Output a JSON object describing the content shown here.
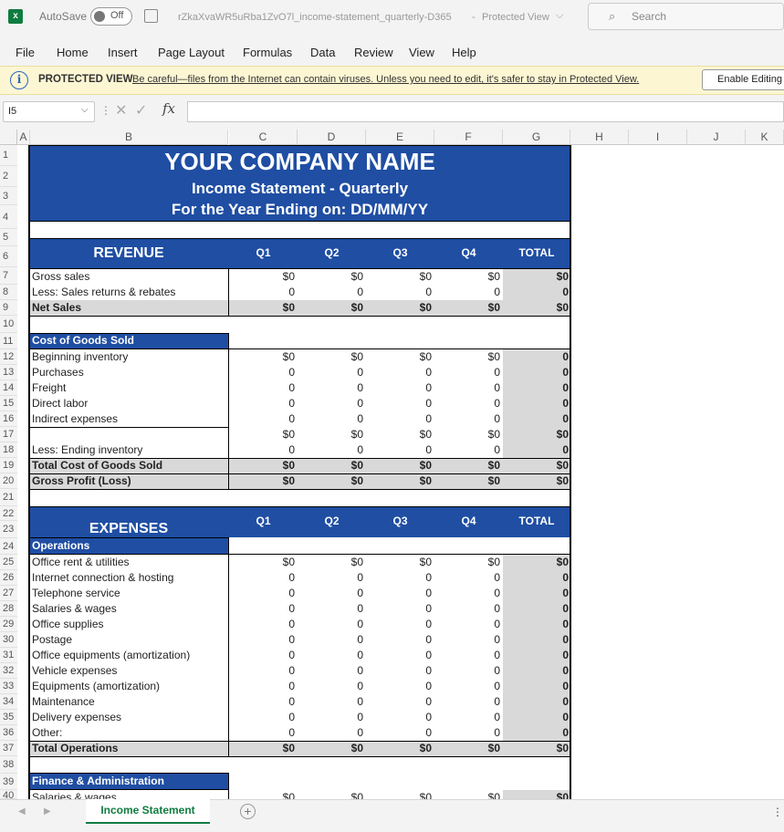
{
  "titlebar": {
    "autosave_label": "AutoSave",
    "autosave_state": "Off",
    "filename": "rZkaXvaWR5uRba1ZvO7l_income-statement_quarterly-D365",
    "separator": "-",
    "view_mode": "Protected View",
    "search_placeholder": "Search"
  },
  "menu": [
    "File",
    "Home",
    "Insert",
    "Page Layout",
    "Formulas",
    "Data",
    "Review",
    "View",
    "Help"
  ],
  "protected": {
    "label": "PROTECTED VIEW",
    "message": "Be careful—files from the Internet can contain viruses. Unless you need to edit, it's safer to stay in Protected View.",
    "button": "Enable Editing"
  },
  "formula_bar": {
    "cell_ref": "I5",
    "fx": "fx",
    "value": ""
  },
  "columns": [
    "A",
    "B",
    "C",
    "D",
    "E",
    "F",
    "G",
    "H",
    "I",
    "J",
    "K"
  ],
  "rows": [
    "1",
    "2",
    "3",
    "4",
    "5",
    "6",
    "7",
    "8",
    "9",
    "10",
    "11",
    "12",
    "13",
    "14",
    "15",
    "16",
    "17",
    "18",
    "19",
    "20",
    "21",
    "22",
    "23",
    "24",
    "25",
    "26",
    "27",
    "28",
    "29",
    "30",
    "31",
    "32",
    "33",
    "34",
    "35",
    "36",
    "37",
    "38",
    "39",
    "40"
  ],
  "sheet": {
    "company": "YOUR COMPANY NAME",
    "subtitle": "Income Statement - Quarterly",
    "year_ending": "For the Year Ending on: DD/MM/YY",
    "revenue_title": "REVENUE",
    "expenses_title": "EXPENSES",
    "q_headers": [
      "Q1",
      "Q2",
      "Q3",
      "Q4",
      "TOTAL"
    ],
    "cogs_title": "Cost of Goods Sold",
    "operations_title": "Operations",
    "finance_title": "Finance & Administration",
    "finance_first_row": "Salaries & wages"
  },
  "revenue_rows": [
    {
      "label": "Gross sales",
      "vals": [
        "$0",
        "$0",
        "$0",
        "$0",
        "$0"
      ]
    },
    {
      "label": "Less: Sales returns & rebates",
      "vals": [
        "0",
        "0",
        "0",
        "0",
        "0"
      ]
    },
    {
      "label": "Net Sales",
      "vals": [
        "$0",
        "$0",
        "$0",
        "$0",
        "$0"
      ]
    }
  ],
  "cogs_rows": [
    {
      "label": "Beginning inventory",
      "vals": [
        "$0",
        "$0",
        "$0",
        "$0",
        "0"
      ]
    },
    {
      "label": "Purchases",
      "vals": [
        "0",
        "0",
        "0",
        "0",
        "0"
      ]
    },
    {
      "label": "Freight",
      "vals": [
        "0",
        "0",
        "0",
        "0",
        "0"
      ]
    },
    {
      "label": "Direct labor",
      "vals": [
        "0",
        "0",
        "0",
        "0",
        "0"
      ]
    },
    {
      "label": "Indirect expenses",
      "vals": [
        "0",
        "0",
        "0",
        "0",
        "0"
      ]
    },
    {
      "label": "",
      "vals": [
        "$0",
        "$0",
        "$0",
        "$0",
        "$0"
      ]
    },
    {
      "label": "Less: Ending inventory",
      "vals": [
        "0",
        "0",
        "0",
        "0",
        "0"
      ]
    },
    {
      "label": "Total Cost of Goods Sold",
      "vals": [
        "$0",
        "$0",
        "$0",
        "$0",
        "$0"
      ]
    },
    {
      "label": "Gross Profit (Loss)",
      "vals": [
        "$0",
        "$0",
        "$0",
        "$0",
        "$0"
      ]
    }
  ],
  "operations_rows": [
    {
      "label": "Office rent & utilities",
      "vals": [
        "$0",
        "$0",
        "$0",
        "$0",
        "$0"
      ]
    },
    {
      "label": "Internet connection & hosting",
      "vals": [
        "0",
        "0",
        "0",
        "0",
        "0"
      ]
    },
    {
      "label": "Telephone service",
      "vals": [
        "0",
        "0",
        "0",
        "0",
        "0"
      ]
    },
    {
      "label": "Salaries & wages",
      "vals": [
        "0",
        "0",
        "0",
        "0",
        "0"
      ]
    },
    {
      "label": "Office supplies",
      "vals": [
        "0",
        "0",
        "0",
        "0",
        "0"
      ]
    },
    {
      "label": "Postage",
      "vals": [
        "0",
        "0",
        "0",
        "0",
        "0"
      ]
    },
    {
      "label": "Office equipments (amortization)",
      "vals": [
        "0",
        "0",
        "0",
        "0",
        "0"
      ]
    },
    {
      "label": "Vehicle expenses",
      "vals": [
        "0",
        "0",
        "0",
        "0",
        "0"
      ]
    },
    {
      "label": "Equipments (amortization)",
      "vals": [
        "0",
        "0",
        "0",
        "0",
        "0"
      ]
    },
    {
      "label": "Maintenance",
      "vals": [
        "0",
        "0",
        "0",
        "0",
        "0"
      ]
    },
    {
      "label": "Delivery expenses",
      "vals": [
        "0",
        "0",
        "0",
        "0",
        "0"
      ]
    },
    {
      "label": "Other:",
      "vals": [
        "0",
        "0",
        "0",
        "0",
        "0"
      ]
    },
    {
      "label": "Total Operations",
      "vals": [
        "$0",
        "$0",
        "$0",
        "$0",
        "$0"
      ]
    }
  ],
  "finance_first_vals": [
    "$0",
    "$0",
    "$0",
    "$0",
    "$0"
  ],
  "tabs": {
    "active": "Income Statement",
    "add": "+"
  }
}
